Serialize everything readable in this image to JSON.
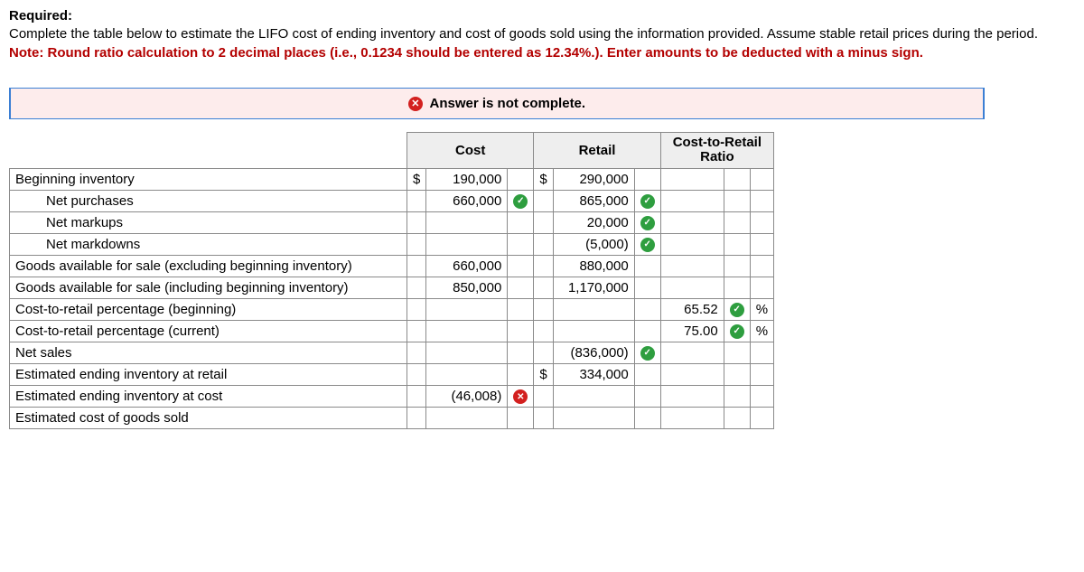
{
  "instructions": {
    "required_label": "Required:",
    "line1": "Complete the table below to estimate the LIFO cost of ending inventory and cost of goods sold using the information provided. Assume stable retail prices during the period.",
    "note": "Note: Round ratio calculation to 2 decimal places (i.e., 0.1234 should be entered as 12.34%.). Enter amounts to be deducted with a minus sign."
  },
  "banner": {
    "text": "Answer is not complete."
  },
  "headers": {
    "cost": "Cost",
    "retail": "Retail",
    "ratio": "Cost-to-Retail Ratio"
  },
  "symbols": {
    "dollar": "$",
    "percent": "%"
  },
  "rows": {
    "beginning_inventory": {
      "label": "Beginning inventory",
      "cost_cur": "$",
      "cost": "190,000",
      "retail_cur": "$",
      "retail": "290,000"
    },
    "net_purchases": {
      "label": "Net purchases",
      "cost": "660,000",
      "cost_ok": true,
      "retail": "865,000",
      "retail_ok": true
    },
    "net_markups": {
      "label": "Net markups",
      "retail": "20,000",
      "retail_ok": true
    },
    "net_markdowns": {
      "label": "Net markdowns",
      "retail": "(5,000)",
      "retail_ok": true
    },
    "gafs_excl": {
      "label": "Goods available for sale (excluding beginning inventory)",
      "cost": "660,000",
      "retail": "880,000"
    },
    "gafs_incl": {
      "label": "Goods available for sale (including beginning inventory)",
      "cost": "850,000",
      "retail": "1,170,000"
    },
    "ctr_beginning": {
      "label": "Cost-to-retail percentage (beginning)",
      "ratio": "65.52",
      "ratio_ok": true
    },
    "ctr_current": {
      "label": "Cost-to-retail percentage (current)",
      "ratio": "75.00",
      "ratio_ok": true
    },
    "net_sales": {
      "label": "Net sales",
      "retail": "(836,000)",
      "retail_ok": true
    },
    "eei_retail": {
      "label": "Estimated ending inventory at retail",
      "retail_cur": "$",
      "retail": "334,000"
    },
    "eei_cost": {
      "label": "Estimated ending inventory at cost",
      "cost": "(46,008)",
      "cost_bad": true
    },
    "ecgs": {
      "label": "Estimated cost of goods sold"
    }
  }
}
